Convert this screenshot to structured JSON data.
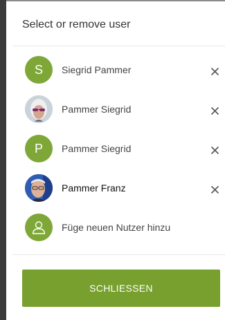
{
  "dialog": {
    "title": "Select or remove user",
    "close_label": "SCHLIESSEN"
  },
  "users": [
    {
      "name": "Siegrid Pammer",
      "avatar": "letter",
      "initial": "S",
      "removable": true
    },
    {
      "name": "Pammer Siegrid",
      "avatar": "photo-woman-sunglasses",
      "removable": true
    },
    {
      "name": "Pammer Siegrid",
      "avatar": "letter",
      "initial": "P",
      "removable": true
    },
    {
      "name": "Pammer Franz",
      "avatar": "photo-man-glasses",
      "removable": true
    }
  ],
  "add_user": {
    "label": "Füge neuen Nutzer hinzu",
    "icon": "user-outline-icon"
  },
  "icons": {
    "remove": "close-icon"
  },
  "colors": {
    "accent": "#77a02e",
    "avatar_bg": "#7ea738",
    "text": "#444444",
    "divider": "#e6e6e6"
  }
}
